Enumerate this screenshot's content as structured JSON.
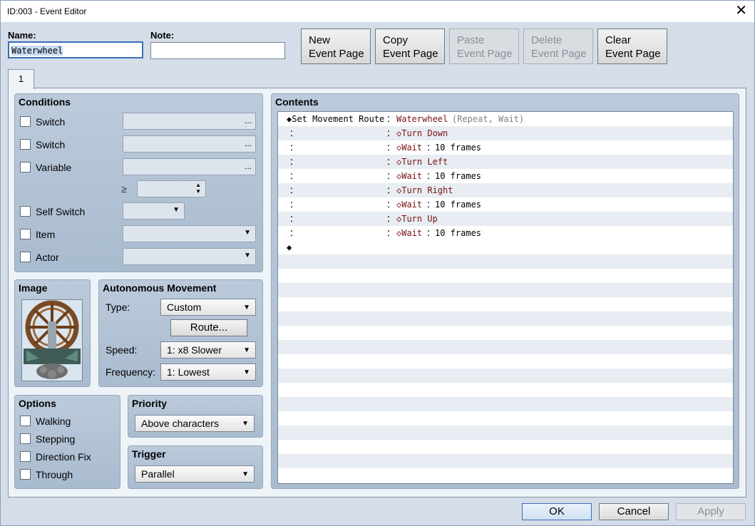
{
  "window": {
    "title": "ID:003 - Event Editor"
  },
  "name_label": "Name:",
  "name_value": "Waterwheel",
  "note_label": "Note:",
  "note_value": "",
  "page_buttons": {
    "new_l1": "New",
    "new_l2": "Event Page",
    "copy_l1": "Copy",
    "copy_l2": "Event Page",
    "paste_l1": "Paste",
    "paste_l2": "Event Page",
    "delete_l1": "Delete",
    "delete_l2": "Event Page",
    "clear_l1": "Clear",
    "clear_l2": "Event Page"
  },
  "tab_label": "1",
  "conditions": {
    "title": "Conditions",
    "switch1": "Switch",
    "switch2": "Switch",
    "variable": "Variable",
    "gte": "≥",
    "self_switch": "Self Switch",
    "item": "Item",
    "actor": "Actor",
    "dots": "..."
  },
  "image": {
    "title": "Image"
  },
  "autonomous": {
    "title": "Autonomous Movement",
    "type_label": "Type:",
    "type_value": "Custom",
    "route_button": "Route...",
    "speed_label": "Speed:",
    "speed_value": "1: x8 Slower",
    "frequency_label": "Frequency:",
    "frequency_value": "1: Lowest"
  },
  "options": {
    "title": "Options",
    "walking": "Walking",
    "stepping": "Stepping",
    "direction_fix": "Direction Fix",
    "through": "Through"
  },
  "priority": {
    "title": "Priority",
    "value": "Above characters"
  },
  "trigger": {
    "title": "Trigger",
    "value": "Parallel"
  },
  "contents": {
    "title": "Contents",
    "cmd0_prefix": "◆Set Movement Route",
    "cmd0_sep": "：",
    "cmd0_target": "Waterwheel",
    "cmd0_opts": "(Repeat, Wait)",
    "cont": "：",
    "steps": [
      {
        "text": "◇Turn Down",
        "arg": ""
      },
      {
        "text": "◇Wait",
        "arg": "：10 frames"
      },
      {
        "text": "◇Turn Left",
        "arg": ""
      },
      {
        "text": "◇Wait",
        "arg": "：10 frames"
      },
      {
        "text": "◇Turn Right",
        "arg": ""
      },
      {
        "text": "◇Wait",
        "arg": "：10 frames"
      },
      {
        "text": "◇Turn Up",
        "arg": ""
      },
      {
        "text": "◇Wait",
        "arg": "：10 frames"
      }
    ],
    "end_marker": "◆"
  },
  "footer": {
    "ok": "OK",
    "cancel": "Cancel",
    "apply": "Apply"
  }
}
